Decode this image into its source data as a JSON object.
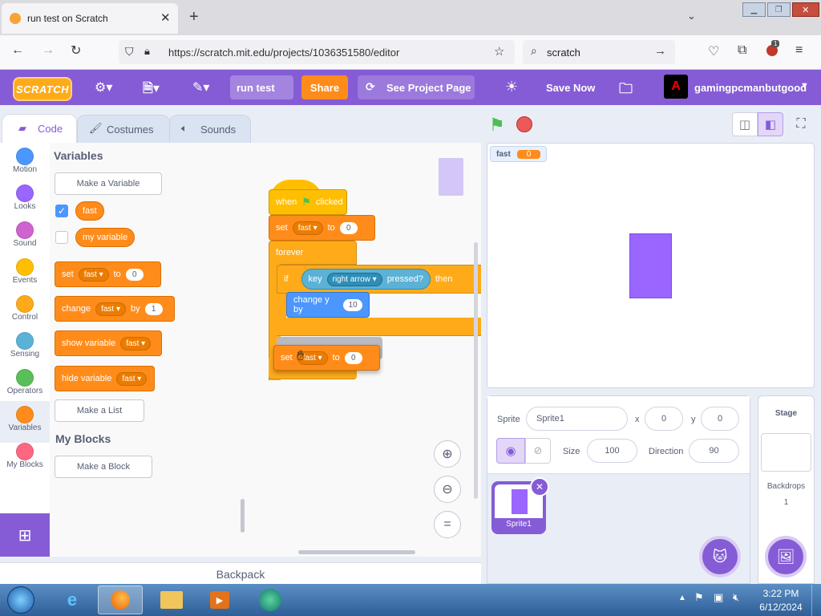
{
  "browser": {
    "tab_title": "run test on Scratch",
    "url": "https://scratch.mit.edu/projects/1036351580/editor",
    "search_text": "scratch",
    "notification_count": "1"
  },
  "menubar": {
    "logo": "SCRATCH",
    "project_title": "run test",
    "share": "Share",
    "see_project_page": "See Project Page",
    "save_now": "Save Now",
    "username": "gamingpcmanbutgood"
  },
  "editor_tabs": {
    "code": "Code",
    "costumes": "Costumes",
    "sounds": "Sounds"
  },
  "categories": [
    {
      "label": "Motion",
      "color": "#4c97ff"
    },
    {
      "label": "Looks",
      "color": "#9966ff"
    },
    {
      "label": "Sound",
      "color": "#cf63cf"
    },
    {
      "label": "Events",
      "color": "#ffbf00"
    },
    {
      "label": "Control",
      "color": "#ffab19"
    },
    {
      "label": "Sensing",
      "color": "#5cb1d6"
    },
    {
      "label": "Operators",
      "color": "#59c059"
    },
    {
      "label": "Variables",
      "color": "#ff8c1a"
    },
    {
      "label": "My Blocks",
      "color": "#ff6680"
    }
  ],
  "palette": {
    "variables_heading": "Variables",
    "make_variable": "Make a Variable",
    "var_fast": "fast",
    "var_my_variable": "my variable",
    "set_label": "set",
    "to_label": "to",
    "set_value": "0",
    "change_label": "change",
    "by_label": "by",
    "change_value": "1",
    "show_variable": "show variable",
    "hide_variable": "hide variable",
    "make_list": "Make a List",
    "my_blocks_heading": "My Blocks",
    "make_block": "Make a Block"
  },
  "script": {
    "when_label": "when",
    "clicked_label": "clicked",
    "set_label": "set",
    "var": "fast",
    "to_label": "to",
    "set_value": "0",
    "forever_label": "forever",
    "if_label": "if",
    "key_label": "key",
    "key_choice": "right arrow",
    "pressed_label": "pressed?",
    "then_label": "then",
    "change_y_label": "change y by",
    "change_y_value": "10",
    "drag_set_label": "set",
    "drag_var": "fast",
    "drag_to_label": "to",
    "drag_value": "0"
  },
  "backpack": "Backpack",
  "stage": {
    "monitor_label": "fast",
    "monitor_value": "0"
  },
  "sprite_info": {
    "sprite_label": "Sprite",
    "sprite_name": "Sprite1",
    "x_label": "x",
    "x_value": "0",
    "y_label": "y",
    "y_value": "0",
    "size_label": "Size",
    "size_value": "100",
    "direction_label": "Direction",
    "direction_value": "90",
    "thumb_name": "Sprite1"
  },
  "stage_panel": {
    "title": "Stage",
    "backdrops_label": "Backdrops",
    "backdrops_count": "1"
  },
  "taskbar": {
    "time": "3:22 PM",
    "date": "6/12/2024"
  }
}
